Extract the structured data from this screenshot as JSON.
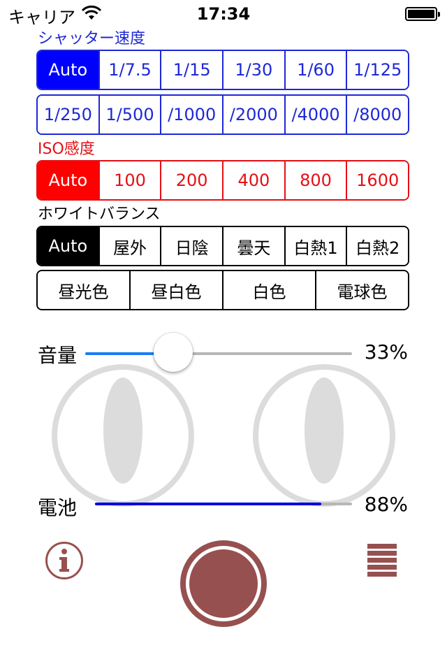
{
  "status_bar": {
    "carrier": "キャリア",
    "time": "17:34",
    "wifi_icon": "wifi-icon",
    "battery_icon": "battery-icon"
  },
  "shutter_speed": {
    "label": "シャッター速度",
    "color": "#0000ff",
    "selected": "Auto",
    "row1": [
      "Auto",
      "1/7.5",
      "1/15",
      "1/30",
      "1/60",
      "1/125"
    ],
    "row2": [
      "1/250",
      "1/500",
      "/1000",
      "/2000",
      "/4000",
      "/8000"
    ]
  },
  "iso": {
    "label": "ISO感度",
    "color": "#ff0000",
    "selected": "Auto",
    "options": [
      "Auto",
      "100",
      "200",
      "400",
      "800",
      "1600"
    ]
  },
  "white_balance": {
    "label": "ホワイトバランス",
    "color": "#000000",
    "selected": "Auto",
    "row1": [
      "Auto",
      "屋外",
      "日陰",
      "曇天",
      "白熱1",
      "白熱2"
    ],
    "row2": [
      "昼光色",
      "昼白色",
      "白色",
      "電球色"
    ]
  },
  "volume": {
    "label": "音量",
    "value_text": "33%",
    "fraction": 0.33,
    "fill_color": "#1a7cf5"
  },
  "battery": {
    "label": "電池",
    "value_text": "88%",
    "fraction": 0.88,
    "fill_color": "#0000dd"
  },
  "eyes": {
    "left_icon": "cat-eye-icon",
    "right_icon": "cat-eye-icon",
    "color": "#dcdcdc"
  },
  "bottom_bar": {
    "info_icon": "info-icon",
    "shutter_icon": "shutter-button-icon",
    "menu_icon": "menu-icon",
    "accent": "#975050"
  }
}
